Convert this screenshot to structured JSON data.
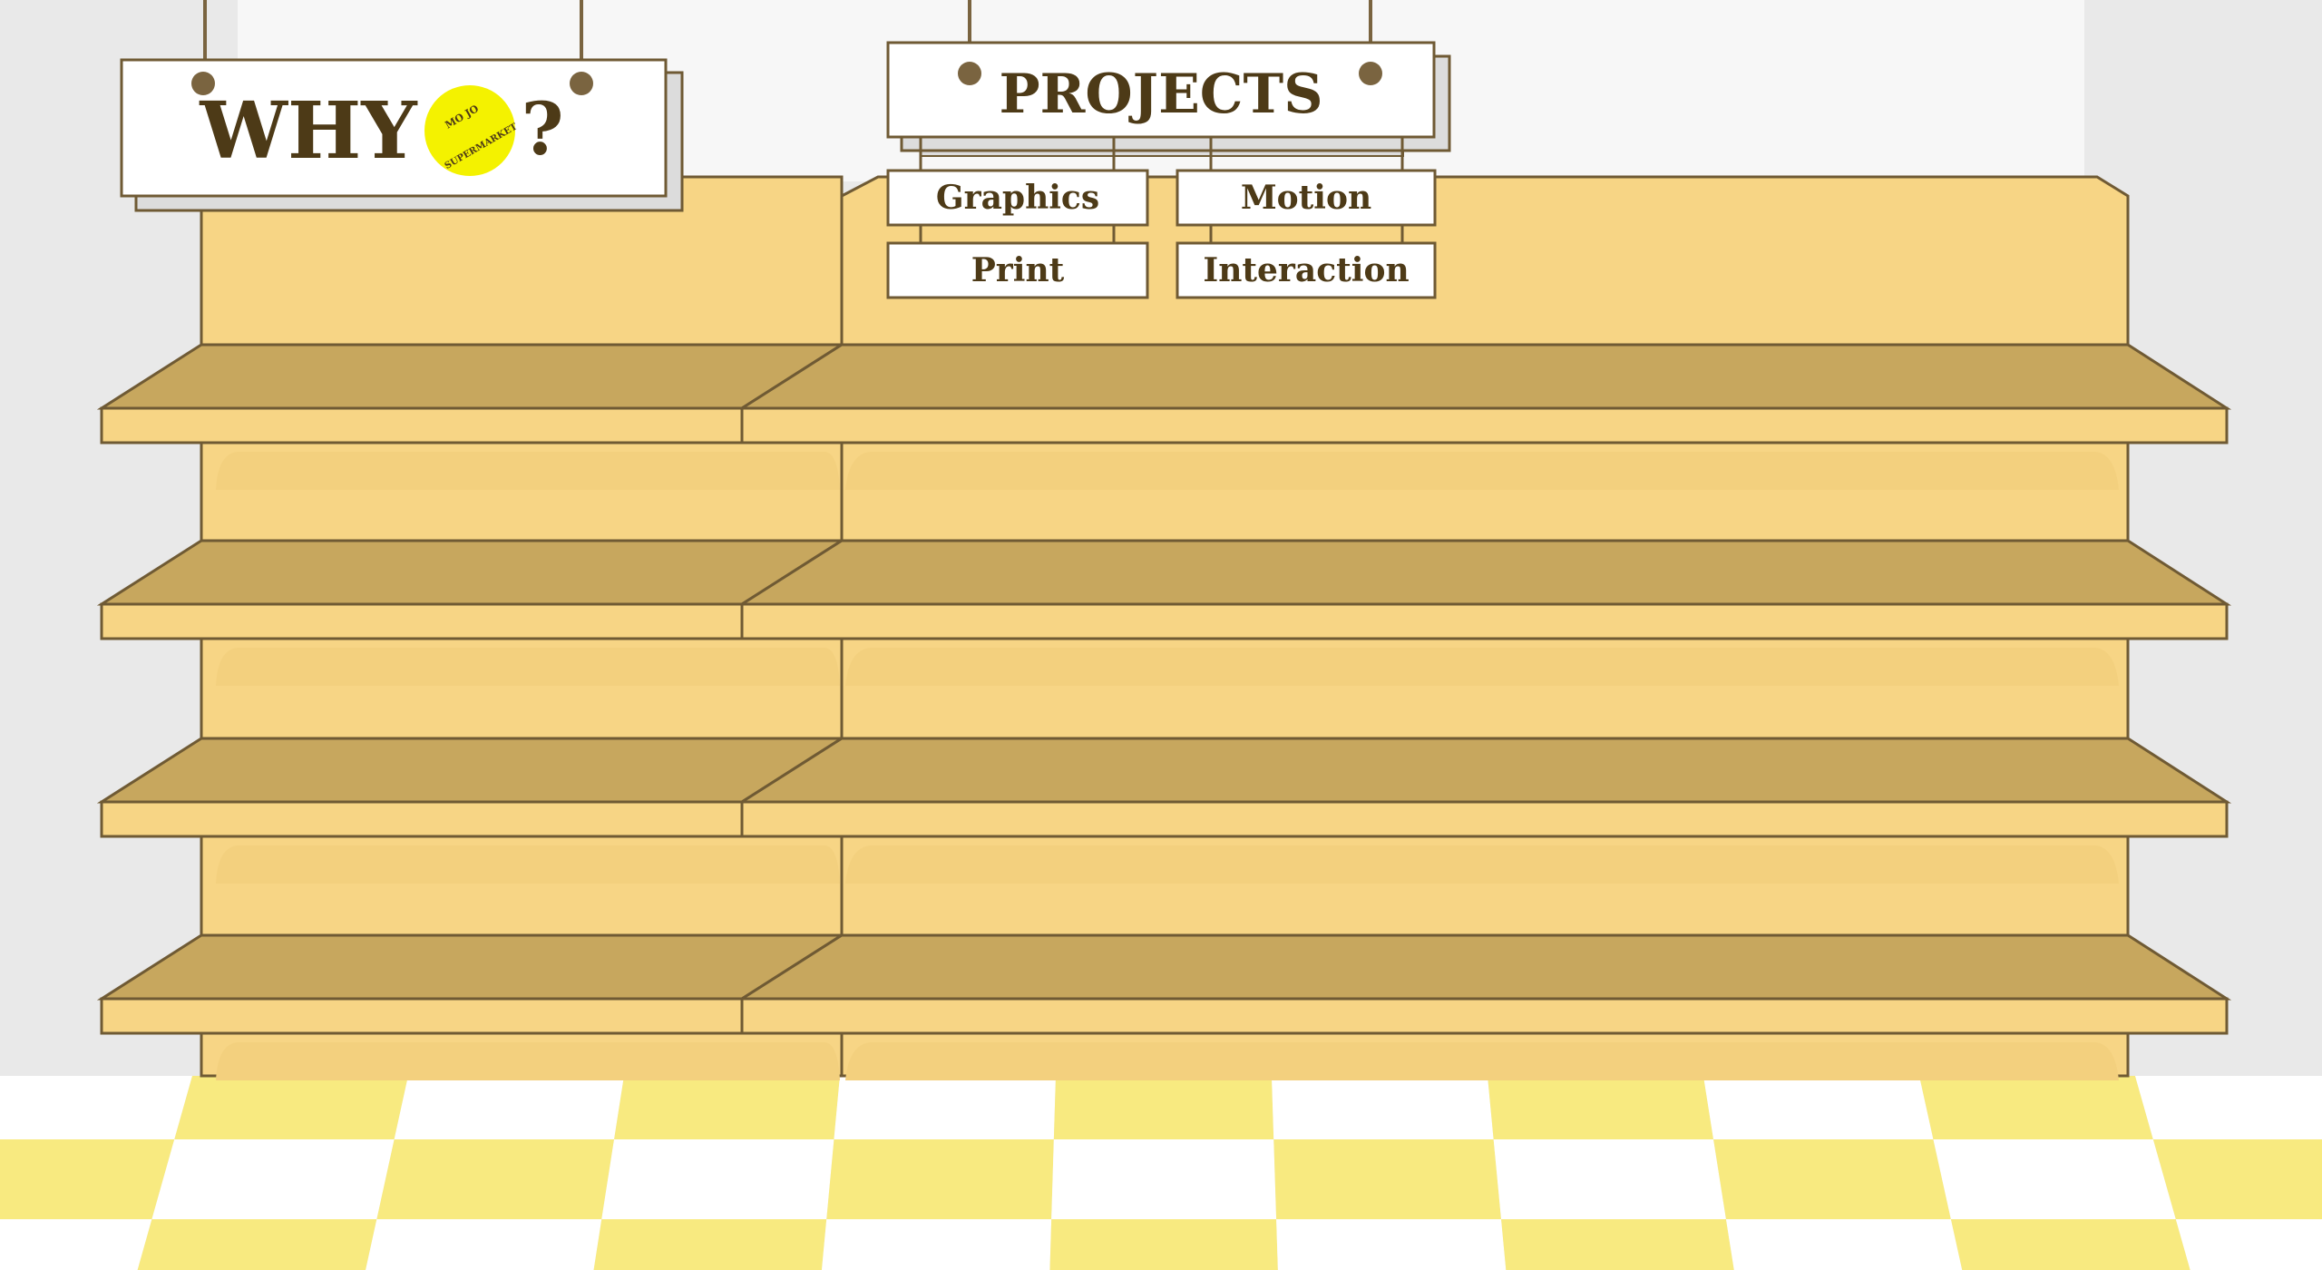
{
  "why_sign": {
    "word": "WHY",
    "question_mark": "?",
    "logo_top": "MO JO",
    "logo_bottom": "SUPERMARKET"
  },
  "projects_sign": {
    "title": "PROJECTS"
  },
  "categories": [
    {
      "label": "Graphics"
    },
    {
      "label": "Motion"
    },
    {
      "label": "Print"
    },
    {
      "label": "Interaction"
    }
  ],
  "colors": {
    "wall": "#e9e9e9",
    "back_wall": "#f7f7f7",
    "shelf_light": "#f7d585",
    "shelf_dark": "#c7a75e",
    "outline": "#6f5a34",
    "text": "#4d3a17",
    "logo_yellow": "#f4f200",
    "floor_yellow": "#f8ea80",
    "floor_white": "#ffffff"
  }
}
